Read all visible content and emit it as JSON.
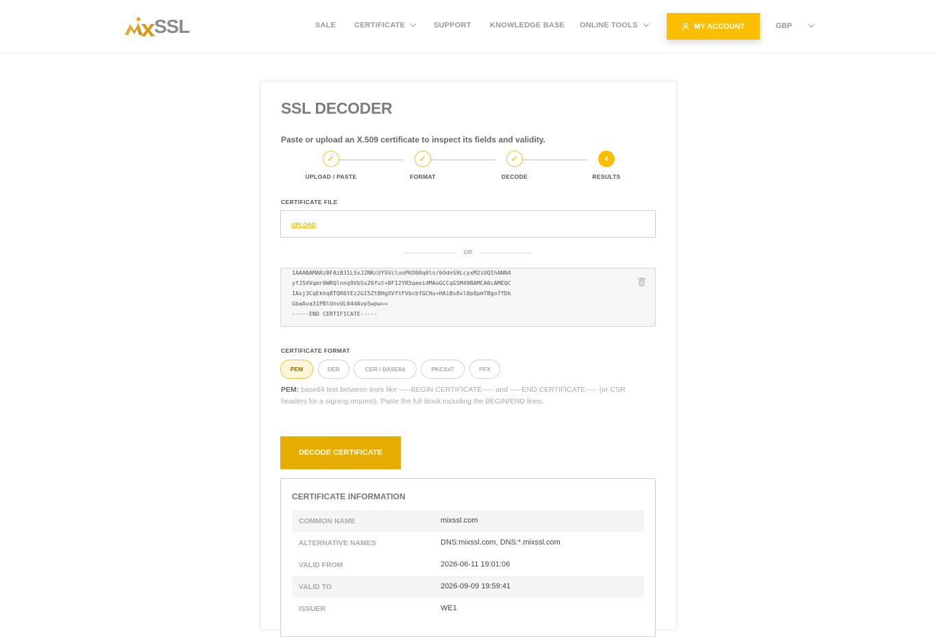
{
  "header": {
    "logo_text": "SSL",
    "nav": [
      {
        "label": "SALE",
        "dropdown": false
      },
      {
        "label": "CERTIFICATE",
        "dropdown": true
      },
      {
        "label": "SUPPORT",
        "dropdown": false
      },
      {
        "label": "KNOWLEDGE BASE",
        "dropdown": false
      },
      {
        "label": "ONLINE TOOLS",
        "dropdown": true
      }
    ],
    "account_label": "MY ACCOUNT",
    "currency": "GBP"
  },
  "colors": {
    "accent": "#fbbf00",
    "accent_dark": "#e6ac00"
  },
  "decoder": {
    "title": "SSL DECODER",
    "subtitle": "Paste or upload an X.509 certificate to inspect its fields and validity.",
    "steps": [
      {
        "label": "UPLOAD / PASTE",
        "state": "done",
        "marker": "✓"
      },
      {
        "label": "FORMAT",
        "state": "done",
        "marker": "✓"
      },
      {
        "label": "DECODE",
        "state": "done",
        "marker": "✓"
      },
      {
        "label": "RESULTS",
        "state": "active",
        "marker": "4"
      }
    ],
    "file_label": "CERTIFICATE FILE",
    "upload_label": "UPLOAD",
    "or_label": "OR",
    "pem_text": "1AAABAMARzBFAiB31LSxJ2NKcUYSVcluoPKO00q0ln/6OdnS9LcyxM2iUQIhANN4\nyfJ5XVqmr0WRQlnnq9VbSsZ6fut+BFI2YR5qeeidMAoGCCqGSM49BAMCA0cAMEQC\nIAsj3CqEkhq8TQR6YEz2GI5ZtBHgXVftFVbcbfGCHu+HAiBs8xl0p8pmTBgo7fDk\nGbaAva31PBlUnvUL04dAvp5wpw==\n-----END CERTIFICATE-----",
    "format_label": "CERTIFICATE FORMAT",
    "formats": [
      "PEM",
      "DER",
      "CER / BASE64",
      "PKCS#7",
      "PFX"
    ],
    "selected_format": "PEM",
    "format_desc_key": "PEM:",
    "format_desc": "base64 text between lines like -----BEGIN CERTIFICATE----- and -----END CERTIFICATE----- (or CSR headers for a signing request). Paste the full block including the BEGIN/END lines.",
    "decode_label": "DECODE CERTIFICATE"
  },
  "info": {
    "title": "CERTIFICATE INFORMATION",
    "rows": [
      {
        "key": "COMMON NAME",
        "value": "mixssl.com"
      },
      {
        "key": "ALTERNATIVE NAMES",
        "value": "DNS:mixssl.com, DNS:*.mixssl.com"
      },
      {
        "key": "VALID FROM",
        "value": "2026-06-11 19:01:06"
      },
      {
        "key": "VALID TO",
        "value": "2026-09-09 19:59:41"
      },
      {
        "key": "ISSUER",
        "value": "WE1"
      }
    ]
  }
}
